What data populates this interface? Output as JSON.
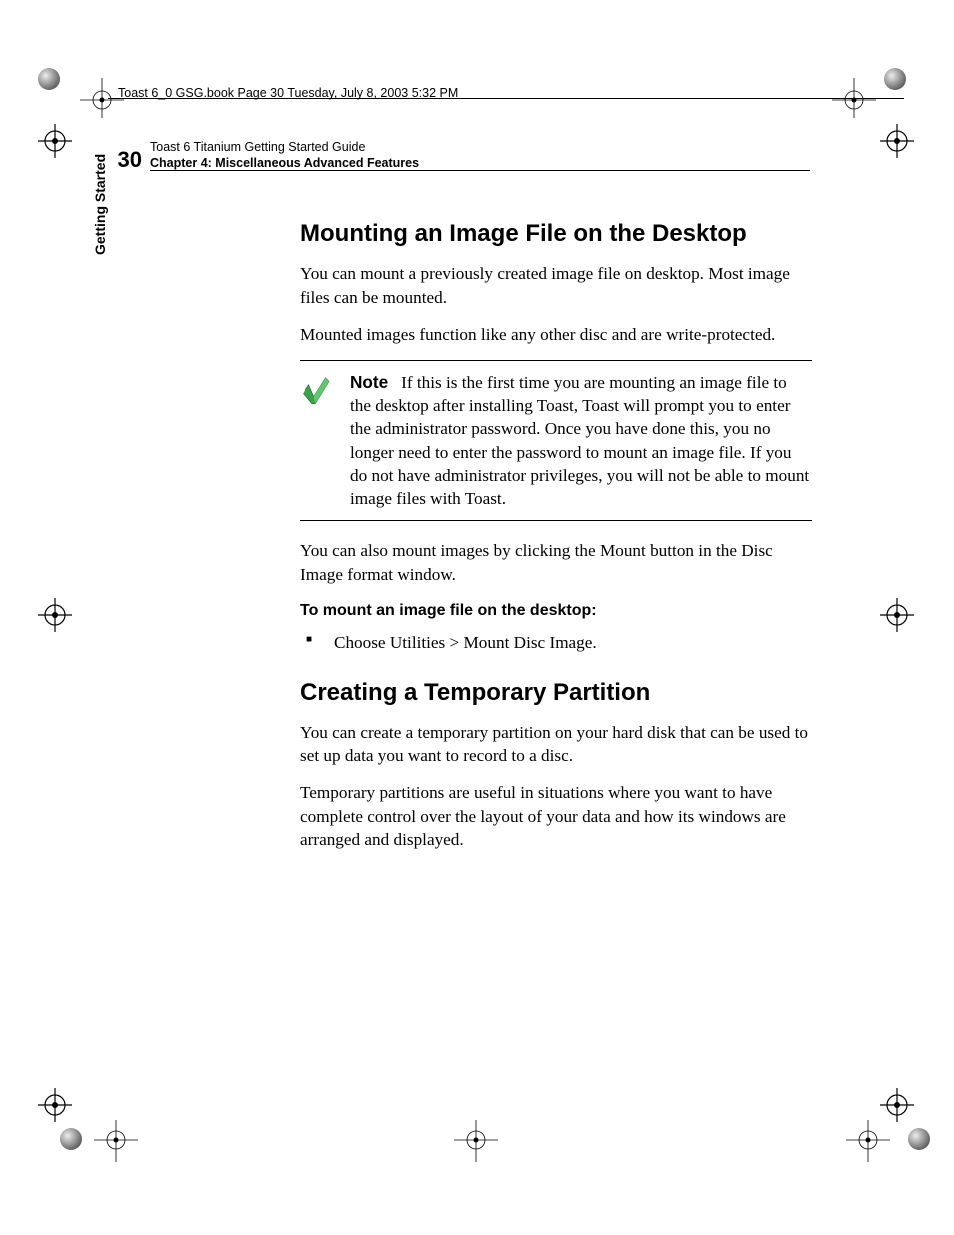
{
  "slug": "Toast 6_0 GSG.book  Page 30  Tuesday, July 8, 2003  5:32 PM",
  "header": {
    "page_number": "30",
    "line1": "Toast 6 Titanium Getting Started Guide",
    "line2": "Chapter 4: Miscellaneous Advanced Features"
  },
  "side_tab": "Getting Started",
  "section1": {
    "heading": "Mounting an Image File on the Desktop",
    "p1": "You can mount a previously created image file on desktop. Most image files can be mounted.",
    "p2": "Mounted images function like any other disc and are write-protected.",
    "note_label": "Note",
    "note_body": "If this is the first time you are mounting an image file to the desktop after installing Toast, Toast will prompt you to enter the administrator password. Once you have done this, you no longer need to enter the password to mount an image file. If you do not have administrator privileges, you will not be able to mount image files with Toast.",
    "p3": "You can also mount images by clicking the Mount button in the Disc Image format window.",
    "proc_head": "To mount an image file on the desktop:",
    "bullet1": "Choose Utilities > Mount Disc Image."
  },
  "section2": {
    "heading": "Creating a Temporary Partition",
    "p1": "You can create a temporary partition on your hard disk that can be used to set up data you want to record to a disc.",
    "p2": "Temporary partitions are useful in situations where you want to have complete control over the layout of your data and how its windows are arranged and displayed."
  },
  "icons": {
    "checkmark": "checkmark-icon"
  }
}
